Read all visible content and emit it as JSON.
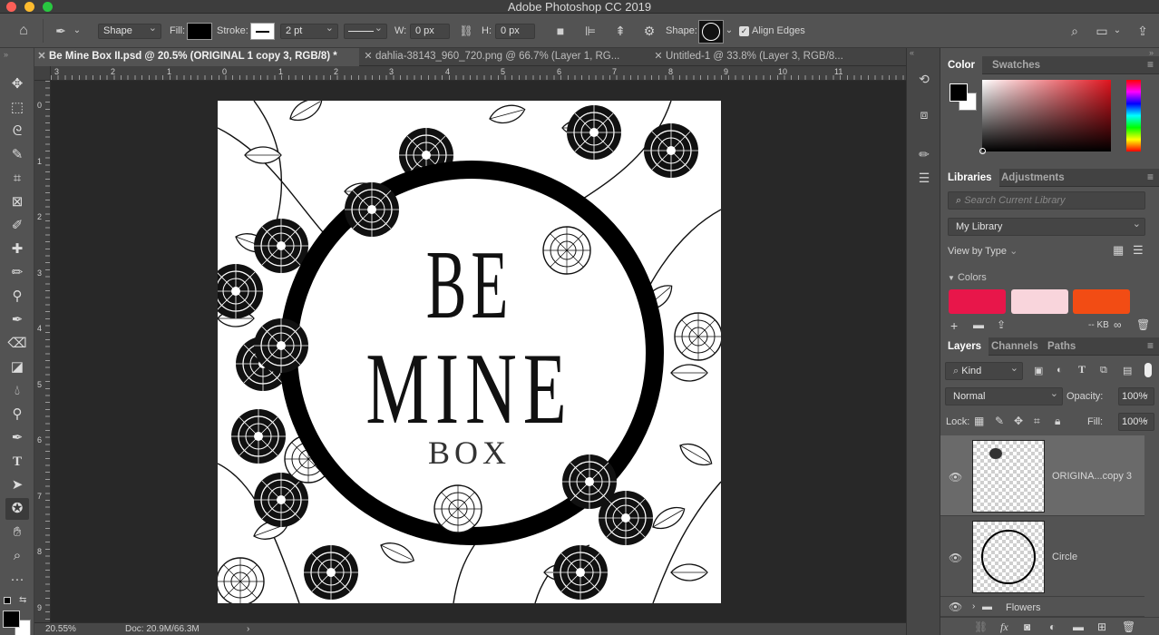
{
  "window": {
    "title": "Adobe Photoshop CC 2019",
    "traffic_lights": [
      "#fc5f57",
      "#fdbb2e",
      "#28c840"
    ]
  },
  "options_bar": {
    "shape_mode": "Shape",
    "fill_label": "Fill:",
    "stroke_label": "Stroke:",
    "stroke_width": "2 pt",
    "w_label": "W:",
    "w_value": "0 px",
    "h_label": "H:",
    "h_value": "0 px",
    "shape_label": "Shape:",
    "align_edges_label": "Align Edges",
    "align_edges_checked": true
  },
  "tabs": [
    {
      "label": "Be Mine Box II.psd @ 20.5% (ORIGINAL 1 copy 3, RGB/8) *",
      "active": true
    },
    {
      "label": "dahlia-38143_960_720.png @ 66.7% (Layer 1, RG...",
      "active": false
    },
    {
      "label": "Untitled-1 @ 33.8% (Layer 3, RGB/8...",
      "active": false
    }
  ],
  "rulers": {
    "horizontal": [
      "3",
      "2",
      "1",
      "0",
      "1",
      "2",
      "3",
      "4",
      "5",
      "6",
      "7",
      "8",
      "9",
      "10",
      "11"
    ],
    "vertical": [
      "0",
      "1",
      "2",
      "3",
      "4",
      "5",
      "6",
      "7",
      "8",
      "9"
    ]
  },
  "artwork": {
    "line1": "BE",
    "line2": "MINE",
    "line3": "BOX"
  },
  "status": {
    "zoom": "20.55%",
    "doc_info": "Doc: 20.9M/66.3M"
  },
  "color_panel": {
    "tabs": [
      "Color",
      "Swatches"
    ],
    "foreground": "#000000",
    "background": "#ffffff",
    "field_hue": "#e0141e"
  },
  "libraries_panel": {
    "tabs": [
      "Libraries",
      "Adjustments"
    ],
    "search_placeholder": "Search Current Library",
    "library_name": "My Library",
    "view_by": "View by Type",
    "colors_section": "Colors",
    "swatches": [
      "#e8164a",
      "#f9d5dc",
      "#f24c14"
    ],
    "storage": "-- KB"
  },
  "layers_panel": {
    "tabs": [
      "Layers",
      "Channels",
      "Paths"
    ],
    "filter_kind": "Kind",
    "blend_mode": "Normal",
    "opacity_label": "Opacity:",
    "opacity_value": "100%",
    "lock_label": "Lock:",
    "fill_label": "Fill:",
    "fill_value": "100%",
    "layers": [
      {
        "name": "ORIGINA...copy 3",
        "selected": true
      },
      {
        "name": "Circle",
        "selected": false
      },
      {
        "name": "Flowers",
        "selected": false,
        "group": true
      }
    ]
  }
}
